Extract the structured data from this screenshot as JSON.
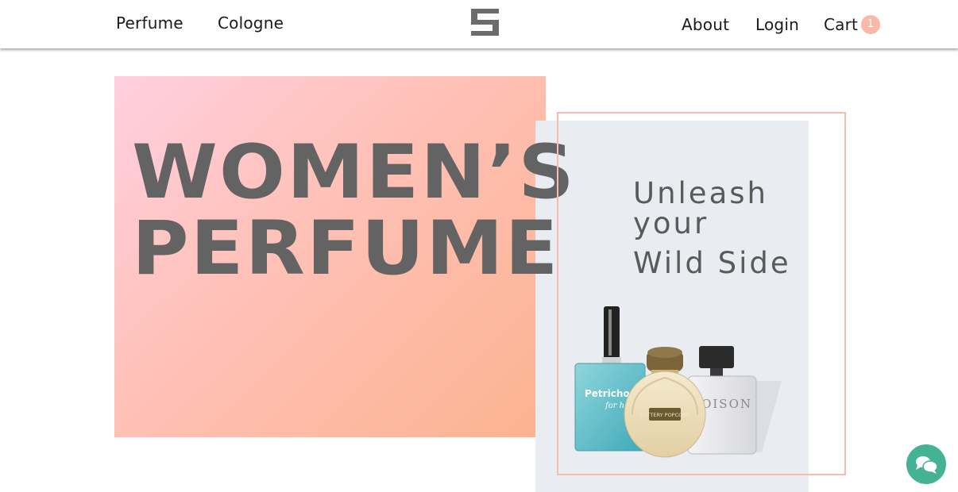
{
  "nav": {
    "left": [
      "Perfume",
      "Cologne"
    ],
    "right": [
      "About",
      "Login",
      "Cart"
    ],
    "cart_count": "1"
  },
  "hero": {
    "title_line1": "WOMEN’S",
    "title_line2": "PERFUME"
  },
  "ad": {
    "line1": "Unleash",
    "line2": "your",
    "line3": "Wild Side",
    "bottle_labels": [
      "Petrichor",
      "BUTTERY POPCORN",
      "POISON"
    ]
  },
  "colors": {
    "title_gray": "#636363",
    "gradient_start": "#ffcfdf",
    "gradient_end": "#fbb28f",
    "outline": "#f6bcb0",
    "chat_green": "#45b296",
    "badge": "#f9b8a8"
  }
}
